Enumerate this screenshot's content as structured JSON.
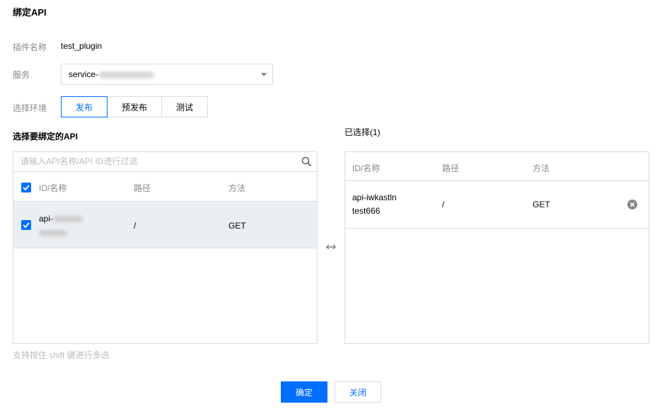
{
  "dialog": {
    "title": "绑定API"
  },
  "plugin": {
    "label": "插件名称",
    "value": "test_plugin"
  },
  "service": {
    "label": "服务",
    "value_prefix": "service-"
  },
  "env": {
    "label": "选择环境",
    "options": [
      "发布",
      "预发布",
      "测试"
    ],
    "selected": "发布"
  },
  "left": {
    "title": "选择要绑定的API",
    "search_placeholder": "请输入API名称/API ID进行过滤",
    "columns": [
      "ID/名称",
      "路径",
      "方法"
    ],
    "rows": [
      {
        "id_prefix": "api-",
        "path": "/",
        "method": "GET",
        "checked": true
      }
    ]
  },
  "right": {
    "title": "已选择(1)",
    "columns": [
      "ID/名称",
      "路径",
      "方法"
    ],
    "rows": [
      {
        "id": "api-iwkastln",
        "name": "test666",
        "path": "/",
        "method": "GET"
      }
    ]
  },
  "hint": "支持按住 shift 键进行多选",
  "buttons": {
    "confirm": "确定",
    "close": "关闭"
  },
  "colors": {
    "primary": "#006eff",
    "border": "#dcdcdc",
    "selected_row": "#ebeef2"
  }
}
